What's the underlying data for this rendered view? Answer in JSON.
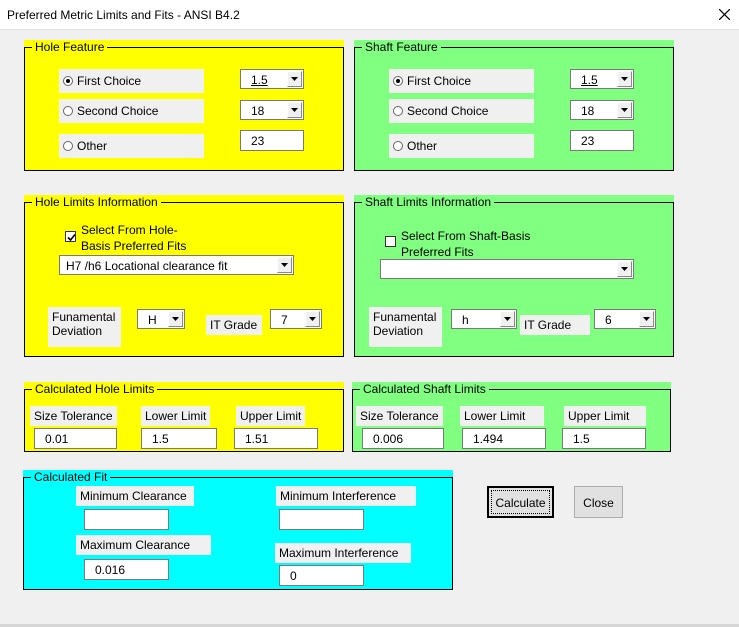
{
  "window": {
    "title": "Preferred Metric Limits and Fits - ANSI B4.2"
  },
  "hole_feature": {
    "legend": "Hole Feature",
    "options": [
      "First Choice",
      "Second Choice",
      "Other"
    ],
    "selected": "First Choice",
    "first_choice_value": "1.5",
    "second_choice_value": "18",
    "other_value": "23"
  },
  "shaft_feature": {
    "legend": "Shaft Feature",
    "options": [
      "First Choice",
      "Second Choice",
      "Other"
    ],
    "selected": "First Choice",
    "first_choice_value": "1.5",
    "second_choice_value": "18",
    "other_value": "23"
  },
  "hole_limits_info": {
    "legend": "Hole Limits Information",
    "checkbox_label_1": "Select From Hole-",
    "checkbox_label_2": "Basis Preferred Fits",
    "checked": true,
    "fit_value": "H7 /h6 Locational clearance fit",
    "fund_dev_label_1": "Funamental",
    "fund_dev_label_2": "Deviation",
    "fund_dev_value": "H",
    "it_grade_label": "IT Grade",
    "it_grade_value": "7"
  },
  "shaft_limits_info": {
    "legend": "Shaft Limits Information",
    "checkbox_label_1": "Select From Shaft-Basis",
    "checkbox_label_2": "Preferred Fits",
    "checked": false,
    "fit_value": "",
    "fund_dev_label_1": "Funamental",
    "fund_dev_label_2": "Deviation",
    "fund_dev_value": "h",
    "it_grade_label": "IT Grade",
    "it_grade_value": "6"
  },
  "calc_hole": {
    "legend": "Calculated Hole Limits",
    "size_tol_label": "Size Tolerance",
    "lower_label": "Lower Limit",
    "upper_label": "Upper Limit",
    "size_tol": "0.01",
    "lower": "1.5",
    "upper": "1.51"
  },
  "calc_shaft": {
    "legend": "Calculated Shaft Limits",
    "size_tol_label": "Size Tolerance",
    "lower_label": "Lower Limit",
    "upper_label": "Upper Limit",
    "size_tol": "0.006",
    "lower": "1.494",
    "upper": "1.5"
  },
  "calc_fit": {
    "legend": "Calculated Fit",
    "min_clear_label": "Minimum Clearance",
    "max_clear_label": "Maximum Clearance",
    "min_interf_label": "Minimum Interference",
    "max_interf_label": "Maximum Interference",
    "min_clear": "",
    "max_clear": "0.016",
    "min_interf": "",
    "max_interf": "0"
  },
  "buttons": {
    "calculate": "Calculate",
    "close": "Close"
  },
  "colors": {
    "hole": "#ffff00",
    "shaft": "#80ff80",
    "fit": "#00ffff"
  }
}
